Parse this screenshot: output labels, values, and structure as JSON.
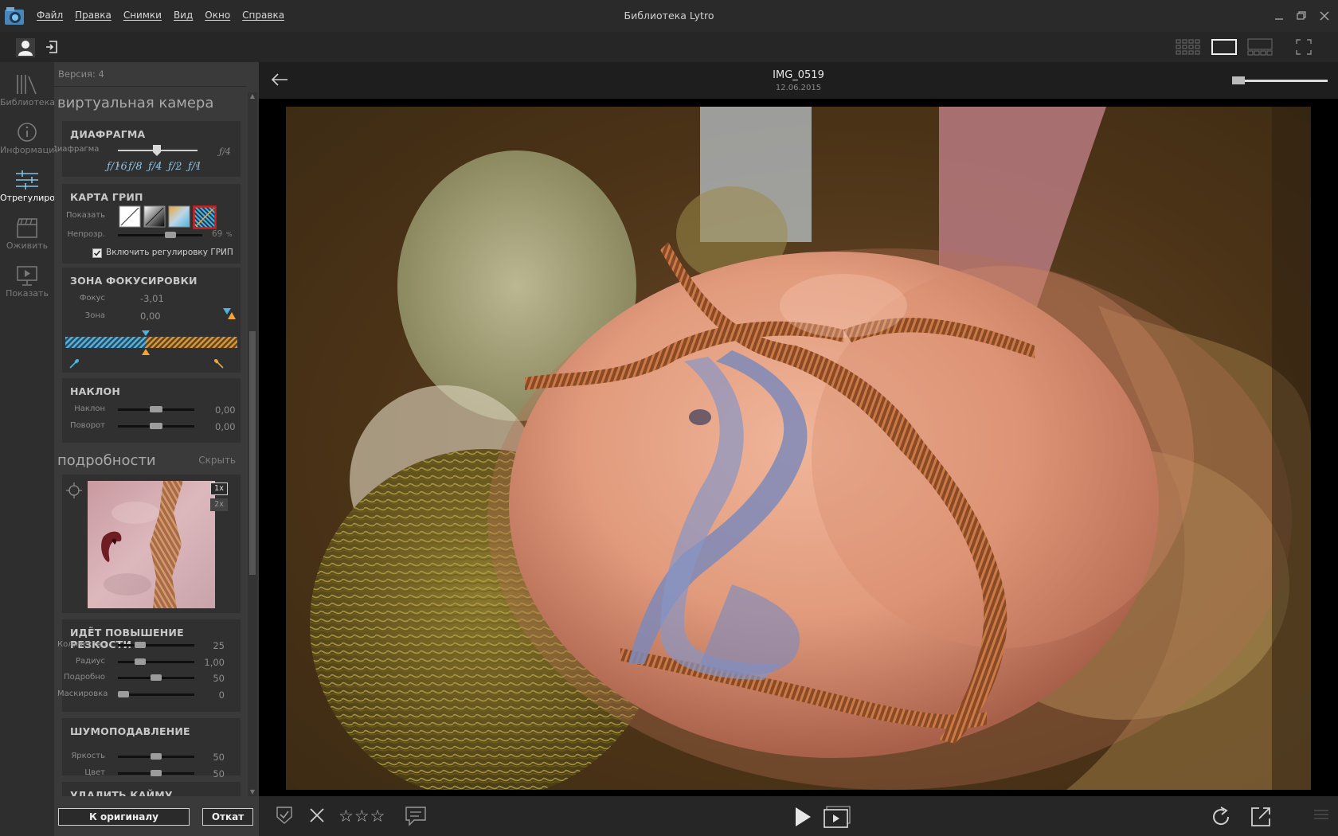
{
  "window": {
    "title": "Библиотека Lytro",
    "menu": [
      "Файл",
      "Правка",
      "Снимки",
      "Вид",
      "Окно",
      "Справка"
    ]
  },
  "leftnav": {
    "items": [
      {
        "label": "Библиотека",
        "icon": "library-icon",
        "active": false
      },
      {
        "label": "Информаци",
        "icon": "info-icon",
        "active": false
      },
      {
        "label": "Отрегулиро",
        "icon": "sliders-icon",
        "active": true
      },
      {
        "label": "Оживить",
        "icon": "clapper-icon",
        "active": false
      },
      {
        "label": "Показать",
        "icon": "present-icon",
        "active": false
      }
    ]
  },
  "panel": {
    "version": "Версия: 4",
    "virtual_camera_title": "виртуальная камера",
    "aperture": {
      "title": "ДИАФРАГМА",
      "label": "Диафрагма",
      "value": "ƒ/4",
      "stops": [
        "ƒ/16",
        "ƒ/8",
        "ƒ/4",
        "ƒ/2",
        "ƒ/1"
      ],
      "level": 0.5
    },
    "depth_map": {
      "title": "КАРТА ГРИП",
      "show_label": "Показать",
      "opacity_label": "Непрозр.",
      "opacity_value": "69",
      "opacity_unit": "%",
      "opacity_level": 0.69,
      "enable_label": "Включить регулировку ГРИП",
      "enabled": true
    },
    "focus_zone": {
      "title": "ЗОНА ФОКУСИРОВКИ",
      "focus_label": "Фокус",
      "focus_value": "-3,01",
      "zone_label": "Зона",
      "zone_value": "0,00"
    },
    "tilt": {
      "title": "НАКЛОН",
      "tilt_label": "Наклон",
      "tilt_value": "0,00",
      "rotate_label": "Поворот",
      "rotate_value": "0,00"
    },
    "details_title": "подробности",
    "hide_label": "Скрыть",
    "zoom_1x": "1x",
    "zoom_2x": "2x",
    "sharpening": {
      "title": "ИДЁТ ПОВЫШЕНИЕ РЕЗКОСТИ",
      "rows": [
        {
          "label": "Количество",
          "value": "25",
          "level": 0.25
        },
        {
          "label": "Радиус",
          "value": "1,00",
          "level": 0.25
        },
        {
          "label": "Подробно",
          "value": "50",
          "level": 0.5
        },
        {
          "label": "Маскировка",
          "value": "0",
          "level": 0.0
        }
      ]
    },
    "noise": {
      "title": "ШУМОПОДАВЛЕНИЕ",
      "rows": [
        {
          "label": "Яркость",
          "value": "50",
          "level": 0.5
        },
        {
          "label": "Цвет",
          "value": "50",
          "level": 0.5
        }
      ]
    },
    "defringe_title": "УДАЛИТЬ КАЙМУ",
    "reset_button": "К оригиналу",
    "revert_button": "Откат"
  },
  "viewer": {
    "image_name": "IMG_0519",
    "image_date": "12.06.2015",
    "rating": "☆☆☆"
  },
  "colors": {
    "accent_blue": "#4fb3e0",
    "accent_orange": "#f0a534",
    "selected_border": "#d02020"
  }
}
